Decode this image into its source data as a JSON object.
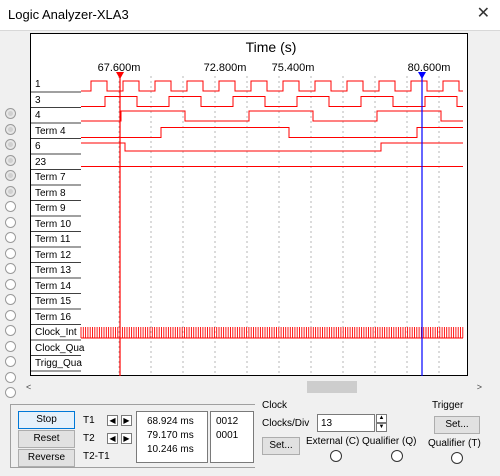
{
  "window": {
    "title": "Logic Analyzer-XLA3",
    "close_glyph": "✕"
  },
  "plot": {
    "axis_title": "Time (s)",
    "ticks": [
      "67.600m",
      "72.800m",
      "75.400m",
      "80.600m"
    ],
    "cursor_colors": {
      "t1": "#ff0000",
      "t2": "#0000ff"
    },
    "trace_color": "#ff0000"
  },
  "channels": [
    {
      "label": "1",
      "active": true
    },
    {
      "label": "3",
      "active": true
    },
    {
      "label": "4",
      "active": true
    },
    {
      "label": "Term 4",
      "active": true
    },
    {
      "label": "6",
      "active": true
    },
    {
      "label": "23",
      "active": true
    },
    {
      "label": "Term 7",
      "active": false
    },
    {
      "label": "Term 8",
      "active": false
    },
    {
      "label": "Term 9",
      "active": false
    },
    {
      "label": "Term 10",
      "active": false
    },
    {
      "label": "Term 11",
      "active": false
    },
    {
      "label": "Term 12",
      "active": false
    },
    {
      "label": "Term 13",
      "active": false
    },
    {
      "label": "Term 14",
      "active": false
    },
    {
      "label": "Term 15",
      "active": false
    },
    {
      "label": "Term 16",
      "active": false
    },
    {
      "label": "Clock_Int",
      "active": false
    },
    {
      "label": "Clock_Qua",
      "active": false
    },
    {
      "label": "Trigg_Qua",
      "active": false
    }
  ],
  "controls": {
    "stop": "Stop",
    "reset": "Reset",
    "reverse": "Reverse",
    "t1_label": "T1",
    "t2_label": "T2",
    "t2t1_label": "T2-T1",
    "t1_value": "68.924 ms",
    "t2_value": "79.170 ms",
    "t2t1_value": "10.246 ms",
    "t1_hex": "0012",
    "t2_hex": "0001",
    "left_arrow": "◀",
    "right_arrow": "▶"
  },
  "clock": {
    "title": "Clock",
    "clocks_div_label": "Clocks/Div",
    "clocks_div_value": "13",
    "set_label": "Set...",
    "external_label": "External (C)",
    "qualifier_label": "Qualifier (Q)"
  },
  "trigger": {
    "title": "Trigger",
    "set_label": "Set...",
    "qualifier_label": "Qualifier (T)"
  }
}
